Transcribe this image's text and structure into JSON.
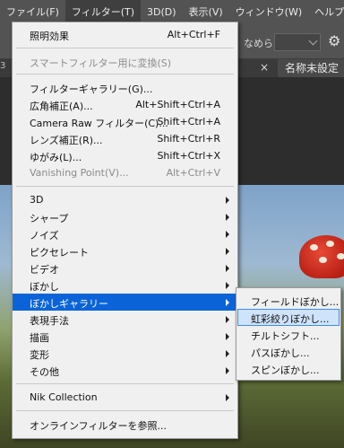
{
  "menubar": {
    "items": [
      {
        "label": "ファイル(F)"
      },
      {
        "label": "フィルター(T)"
      },
      {
        "label": "3D(D)"
      },
      {
        "label": "表示(V)"
      },
      {
        "label": "ウィンドウ(W)"
      },
      {
        "label": "ヘルプ(H)"
      }
    ]
  },
  "optbar": {
    "label": "なめらかさ："
  },
  "tabs": {
    "left_fragment": "3",
    "close": "×",
    "active": "名称未設定"
  },
  "menu": {
    "items": [
      {
        "label": "照明効果",
        "shortcut": "Alt+Ctrl+F"
      },
      {
        "label": "スマートフィルター用に変換(S)"
      },
      {
        "label": "フィルターギャラリー(G)..."
      },
      {
        "label": "広角補正(A)...",
        "shortcut": "Alt+Shift+Ctrl+A"
      },
      {
        "label": "Camera Raw フィルター(C)...",
        "shortcut": "Shift+Ctrl+A"
      },
      {
        "label": "レンズ補正(R)...",
        "shortcut": "Shift+Ctrl+R"
      },
      {
        "label": "ゆがみ(L)...",
        "shortcut": "Shift+Ctrl+X"
      },
      {
        "label": "Vanishing Point(V)...",
        "shortcut": "Alt+Ctrl+V"
      },
      {
        "label": "3D"
      },
      {
        "label": "シャープ"
      },
      {
        "label": "ノイズ"
      },
      {
        "label": "ピクセレート"
      },
      {
        "label": "ビデオ"
      },
      {
        "label": "ぼかし"
      },
      {
        "label": "ぼかしギャラリー"
      },
      {
        "label": "表現手法"
      },
      {
        "label": "描画"
      },
      {
        "label": "変形"
      },
      {
        "label": "その他"
      },
      {
        "label": "Nik Collection"
      },
      {
        "label": "オンラインフィルターを参照..."
      }
    ]
  },
  "submenu": {
    "items": [
      {
        "label": "フィールドぼかし..."
      },
      {
        "label": "虹彩絞りぼかし..."
      },
      {
        "label": "チルトシフト..."
      },
      {
        "label": "パスぼかし..."
      },
      {
        "label": "スピンぼかし..."
      }
    ]
  },
  "colors": {
    "highlight": "#0a64d7",
    "menu_bg": "#f0f0f0",
    "app_chrome": "#535353"
  },
  "icons": {
    "settings": "gear-icon",
    "submenu_arrow": "chevron-right-icon",
    "dropdown_arrow": "chevron-down-icon"
  }
}
